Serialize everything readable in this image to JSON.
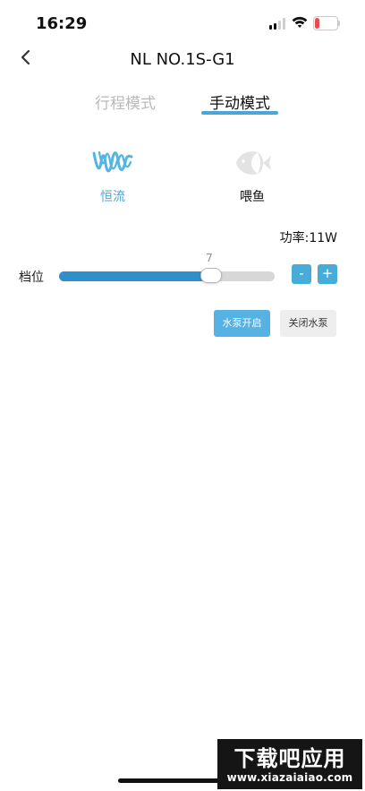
{
  "status_bar": {
    "time": "16:29",
    "battery": {
      "level_percent": 18,
      "label": "18",
      "fill_color": "#e84d4d"
    },
    "icons": {
      "signal": "signal-icon",
      "wifi": "wifi-icon"
    }
  },
  "header": {
    "back_icon": "back-icon",
    "title": "NL NO.1S-G1"
  },
  "tabs": [
    {
      "label": "行程模式",
      "active": false
    },
    {
      "label": "手动模式",
      "active": true
    }
  ],
  "modes": [
    {
      "label": "恒流",
      "icon": "constant-flow-icon",
      "active": true
    },
    {
      "label": "喂鱼",
      "icon": "fish-icon",
      "active": false
    }
  ],
  "power": {
    "text": "功率:11W"
  },
  "slider": {
    "label": "档位",
    "value": "7",
    "fraction": 0.7
  },
  "controls": {
    "minus_label": "-",
    "plus_label": "+",
    "pump_on_label": "水泵开启",
    "pump_off_label": "关闭水泵"
  },
  "watermark": {
    "main": "下载吧应用",
    "sub": "www.xiazaiaiao.com"
  },
  "colors": {
    "accent": "#4aa6d7",
    "slider_fill": "#2f8fcb",
    "button_blue": "#48acd9",
    "inactive_text": "#b9b9b9"
  }
}
